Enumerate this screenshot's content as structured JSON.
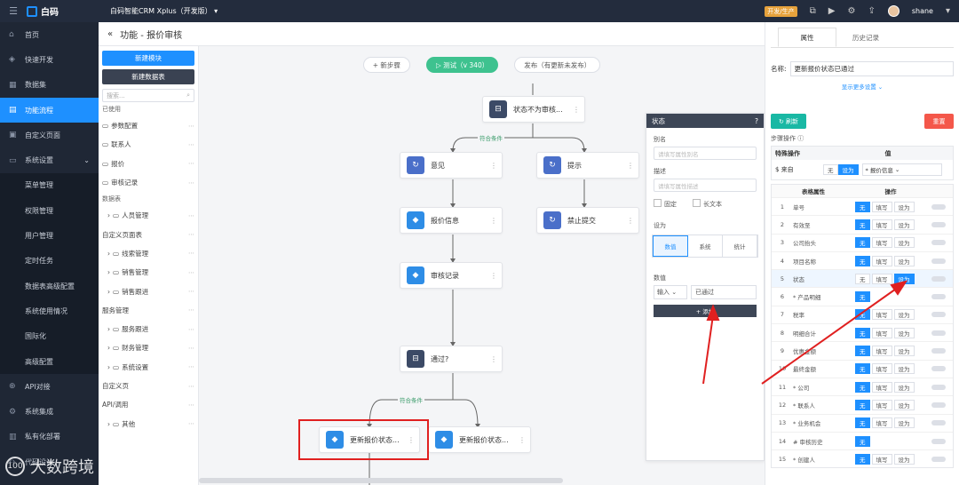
{
  "topbar": {
    "app_logo": "白码",
    "app_name": "白码智能CRM Xplus（开发版）",
    "dev_badge": "开发/生产",
    "username": "shane"
  },
  "sidenav": {
    "items": [
      {
        "label": "首页",
        "icon": "home-icon"
      },
      {
        "label": "快速开发",
        "icon": "cube-icon"
      },
      {
        "label": "数据集",
        "icon": "database-icon"
      },
      {
        "label": "功能流程",
        "icon": "flow-icon",
        "active": true
      },
      {
        "label": "自定义页面",
        "icon": "page-icon"
      },
      {
        "label": "系统设置",
        "icon": "settings-icon",
        "expanded": true
      }
    ],
    "sub_items": [
      "菜单管理",
      "权限管理",
      "用户管理",
      "定时任务",
      "数据表高级配置",
      "系统使用情况",
      "国际化",
      "高级配置"
    ],
    "bottom_items": [
      {
        "label": "API对接"
      },
      {
        "label": "系统集成"
      },
      {
        "label": "私有化部署"
      },
      {
        "label": "代码设计"
      }
    ]
  },
  "watermark": {
    "icon_text": "100",
    "text": "大数跨境"
  },
  "header": {
    "title": "功能 - 报价审核"
  },
  "leftpanel": {
    "new_module": "新建模块",
    "new_table": "新建数据表",
    "search_placeholder": "搜索...",
    "used_label": "已使用",
    "used_items": [
      "参数配置",
      "联系人",
      "报价",
      "审核记录"
    ],
    "table_label": "数据表",
    "tables": [
      {
        "label": "人员管理",
        "indent": true
      },
      {
        "label": "自定义页面表",
        "indent": false
      },
      {
        "label": "线索管理",
        "indent": true
      },
      {
        "label": "销售管理",
        "indent": true
      },
      {
        "label": "销售跟进",
        "indent": true
      },
      {
        "label": "服务管理",
        "indent": false
      },
      {
        "label": "服务跟进",
        "indent": true
      },
      {
        "label": "财务管理",
        "indent": true
      },
      {
        "label": "系统设置",
        "indent": true
      },
      {
        "label": "自定义页",
        "indent": false
      },
      {
        "label": "API/调用",
        "indent": false
      },
      {
        "label": "其他",
        "indent": true
      }
    ]
  },
  "canvas": {
    "add_step": "+ 新步骤",
    "test_label": "▷ 测试（v 340）",
    "publish_label": "发布（有更新未发布）",
    "nodes": {
      "status_check": "状态不为审核...",
      "opinion": "意见",
      "prompt": "提示",
      "quote_info": "报价信息",
      "forbid_submit": "禁止提交",
      "audit_record": "审核记录",
      "passed": "通过?",
      "update_status_1": "更新报价状态...",
      "update_status_2": "更新报价状态..."
    },
    "cond_label_1": "符合条件",
    "cond_label_2": "符合条件"
  },
  "statepanel": {
    "title": "状态",
    "alias_label": "别名",
    "alias_placeholder": "请填写属性别名",
    "desc_label": "描述",
    "desc_placeholder": "请填写属性描述",
    "fixed": "固定",
    "long_text": "长文本",
    "set_label": "设为",
    "seg": [
      "数值",
      "系统",
      "统计"
    ],
    "value_label": "数值",
    "input_mode": "输入",
    "value": "已通过",
    "add_btn": "+ 添加"
  },
  "rightpanel": {
    "tab_props": "属性",
    "tab_history": "历史记录",
    "name_label": "名称:",
    "name_value": "更新报价状态已通过",
    "more_settings": "显示更多设置",
    "refresh": "刷新",
    "reset": "重置",
    "step_ops": "步骤操作",
    "spec_head": {
      "k": "特殊操作",
      "v": "值"
    },
    "spec_row": {
      "k": "$ 来自",
      "chip1": "无",
      "chip2": "设为",
      "dd": "* 报价信息"
    },
    "fields_head": {
      "attr": "表格属性",
      "ops": "操作"
    },
    "fields": [
      {
        "n": "1",
        "nm": "单号",
        "ops": [
          "无",
          "填写",
          "设为"
        ],
        "on": 0
      },
      {
        "n": "2",
        "nm": "有效至",
        "ops": [
          "无",
          "填写",
          "设为"
        ],
        "on": 0
      },
      {
        "n": "3",
        "nm": "公司抬头",
        "ops": [
          "无",
          "填写",
          "设为"
        ],
        "on": 0
      },
      {
        "n": "4",
        "nm": "项目名称",
        "ops": [
          "无",
          "填写",
          "设为"
        ],
        "on": 0
      },
      {
        "n": "5",
        "nm": "状态",
        "ops": [
          "无",
          "填写",
          "设为"
        ],
        "on": 2,
        "sel": true
      },
      {
        "n": "6",
        "nm": "* 产品明细",
        "ops": [
          "无"
        ],
        "on": 0
      },
      {
        "n": "7",
        "nm": "税率",
        "ops": [
          "无",
          "填写",
          "设为"
        ],
        "on": 0
      },
      {
        "n": "8",
        "nm": "明细合计",
        "ops": [
          "无",
          "填写",
          "设为"
        ],
        "on": 0
      },
      {
        "n": "9",
        "nm": "优惠金额",
        "ops": [
          "无",
          "填写",
          "设为"
        ],
        "on": 0
      },
      {
        "n": "10",
        "nm": "最终金额",
        "ops": [
          "无",
          "填写",
          "设为"
        ],
        "on": 0
      },
      {
        "n": "11",
        "nm": "* 公司",
        "ops": [
          "无",
          "填写",
          "设为"
        ],
        "on": 0
      },
      {
        "n": "12",
        "nm": "* 联系人",
        "ops": [
          "无",
          "填写",
          "设为"
        ],
        "on": 0
      },
      {
        "n": "13",
        "nm": "* 业务机会",
        "ops": [
          "无",
          "填写",
          "设为"
        ],
        "on": 0
      },
      {
        "n": "14",
        "nm": "# 审核历史",
        "ops": [
          "无"
        ],
        "on": 0
      },
      {
        "n": "15",
        "nm": "* 创建人",
        "ops": [
          "无",
          "填写",
          "设为"
        ],
        "on": 0
      }
    ]
  }
}
